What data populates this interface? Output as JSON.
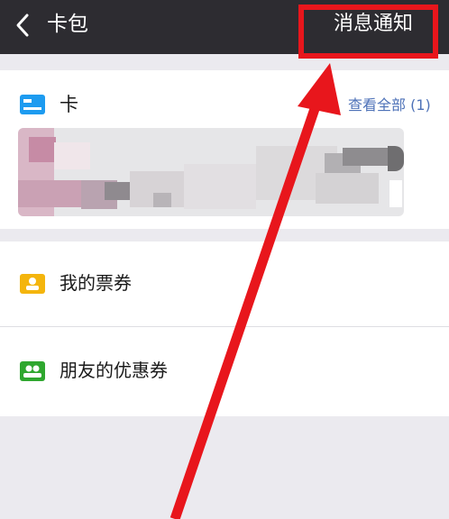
{
  "navbar": {
    "title": "卡包",
    "action_label": "消息通知",
    "back_icon": "chevron-left-icon"
  },
  "cards": {
    "label": "卡",
    "view_all": "查看全部 (1)",
    "icon": "card-icon",
    "accent": "#1d9bf0"
  },
  "menu": {
    "items": [
      {
        "label": "我的票券",
        "icon": "ticket-icon",
        "color": "#f4b50d"
      },
      {
        "label": "朋友的优惠券",
        "icon": "friends-coupon-icon",
        "color": "#2fa72f"
      }
    ]
  },
  "annotation": {
    "highlight_color": "#e8161c"
  }
}
